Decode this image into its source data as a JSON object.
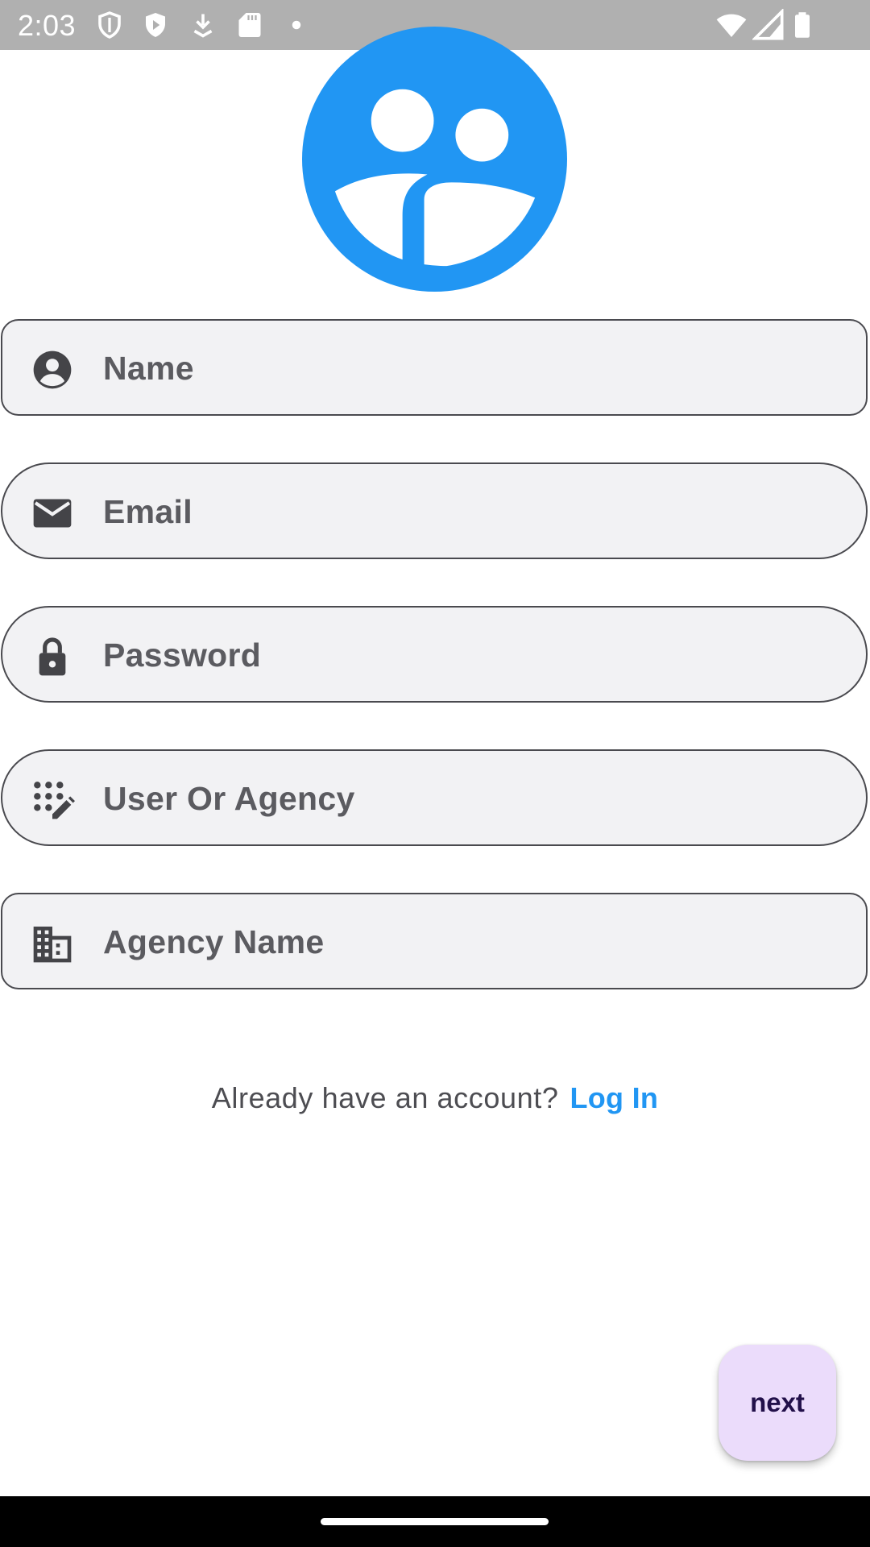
{
  "status_bar": {
    "time": "2:03",
    "left_icons": [
      "shield-icon",
      "play-shield-icon",
      "download-icon",
      "sd-card-icon",
      "dot-icon"
    ],
    "right_icons": [
      "wifi-icon",
      "cell-signal-icon",
      "battery-icon"
    ]
  },
  "logo": {
    "icon": "group-avatar-icon",
    "color": "#2196f3"
  },
  "form": {
    "fields": [
      {
        "icon": "account-circle-icon",
        "placeholder": "Name"
      },
      {
        "icon": "mail-icon",
        "placeholder": "Email"
      },
      {
        "icon": "lock-icon",
        "placeholder": "Password"
      },
      {
        "icon": "magic-pattern-icon",
        "placeholder": "User Or Agency"
      },
      {
        "icon": "business-icon",
        "placeholder": "Agency Name"
      }
    ]
  },
  "login": {
    "prompt": "Already have an account?",
    "link": "Log In"
  },
  "fab": {
    "label": "next"
  },
  "colors": {
    "accent": "#2196f3",
    "field_bg": "#f2f2f4",
    "field_border": "#4a4a4f",
    "fab_bg": "#ebdcfb",
    "fab_text": "#22104a"
  }
}
